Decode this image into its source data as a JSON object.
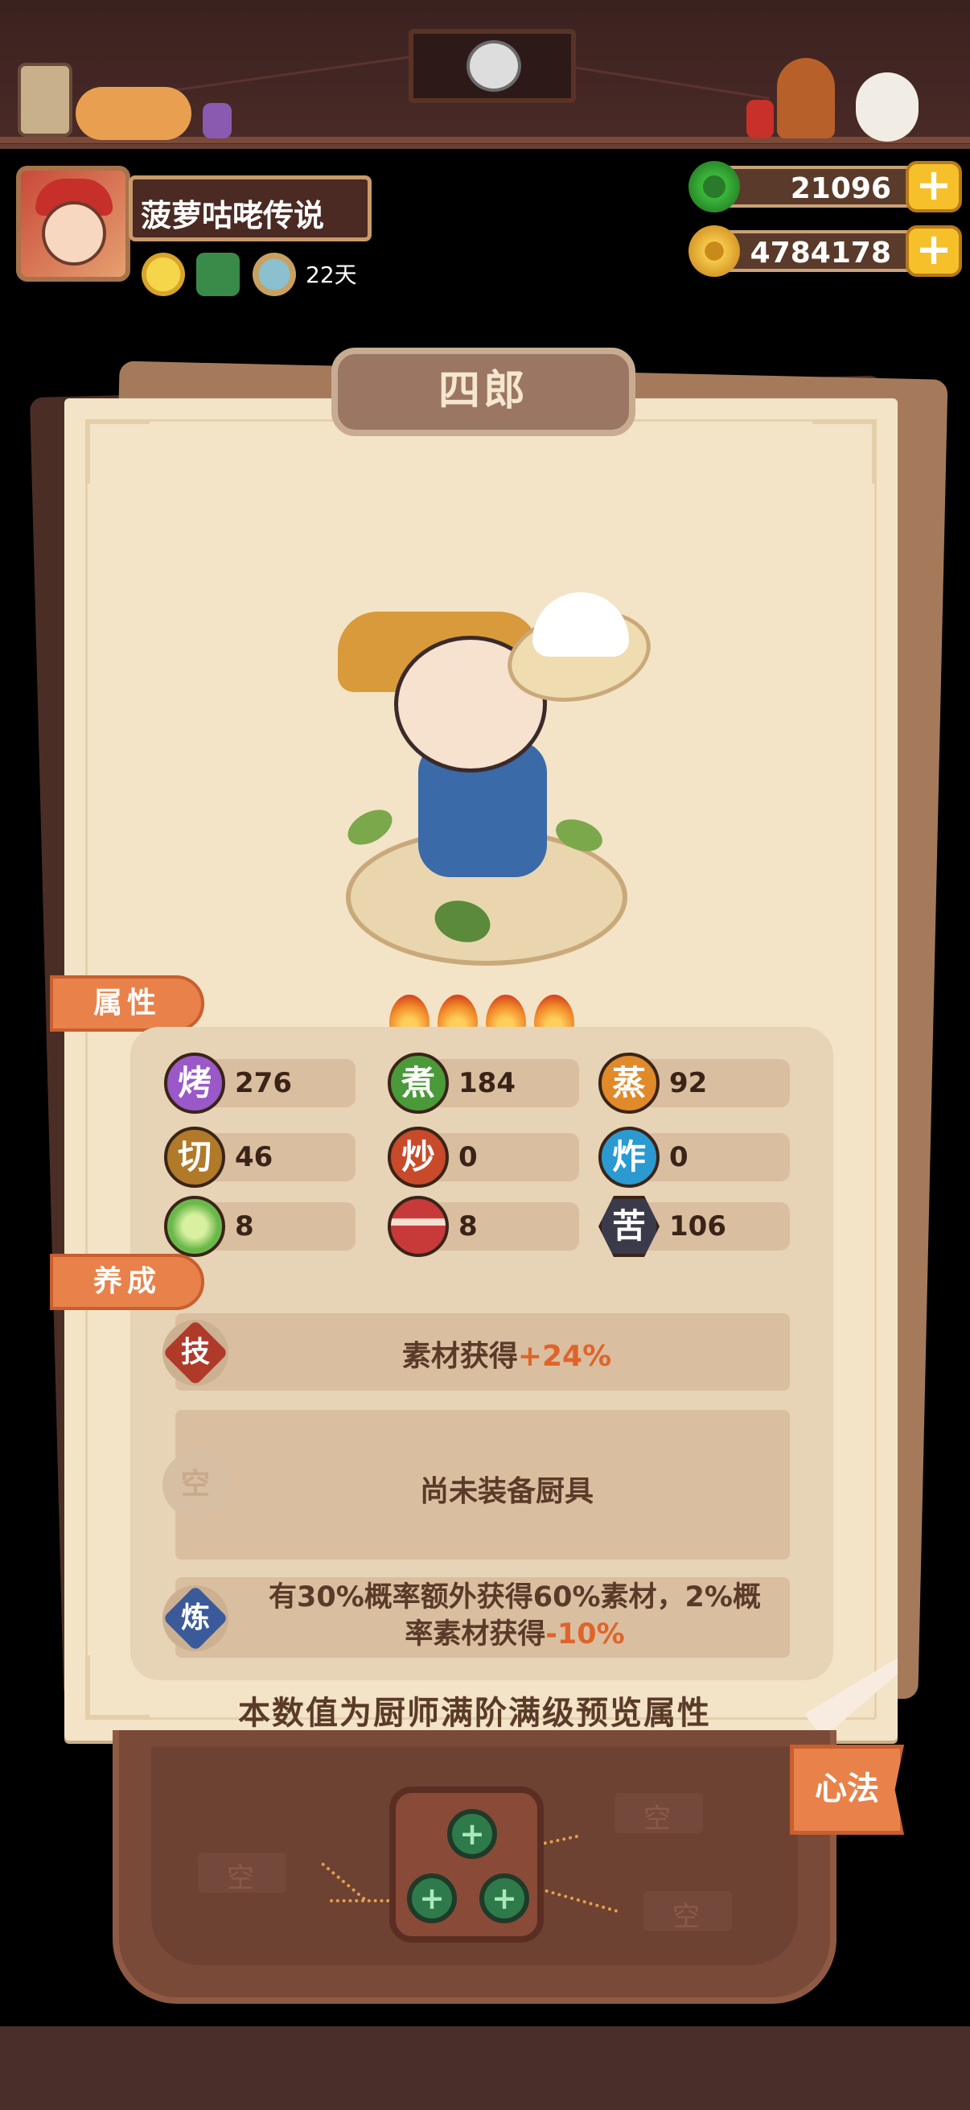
{
  "player": {
    "name": "菠萝咕咾传说",
    "days": "22天"
  },
  "currency": {
    "jade": "21096",
    "coins": "4784178",
    "add_symbol": "+"
  },
  "chef": {
    "name": "四郎",
    "stars": 4
  },
  "tabs": {
    "attributes": "属性",
    "cultivation": "养成",
    "xinfa": "心法"
  },
  "stats": [
    {
      "key": "烤",
      "value": "276",
      "color": "#9a58c8"
    },
    {
      "key": "煮",
      "value": "184",
      "color": "#4a9a3a"
    },
    {
      "key": "蒸",
      "value": "92",
      "color": "#e08a2a"
    },
    {
      "key": "切",
      "value": "46",
      "color": "#b07a2a"
    },
    {
      "key": "炒",
      "value": "0",
      "color": "#c84a2a"
    },
    {
      "key": "炸",
      "value": "0",
      "color": "#2a9ad0"
    },
    {
      "key": "cabbage-icon",
      "value": "8",
      "color": "#6ab84a"
    },
    {
      "key": "meat-icon",
      "value": "8",
      "color": "#c83a3a"
    },
    {
      "key": "苦",
      "value": "106",
      "color": "#3a3a4a"
    }
  ],
  "skill": {
    "badge": "技",
    "text": "素材获得",
    "bonus": "+24%"
  },
  "equipment": {
    "badge": "空",
    "text": "尚未装备厨具"
  },
  "refine": {
    "badge": "炼",
    "line1": "有30%概率额外获得60%素材，2%概",
    "line2_prefix": "率素材获得",
    "line2_bonus": "-10%"
  },
  "footer_note": "本数值为厨师满阶满级预览属性",
  "tray": {
    "empty_label": "空",
    "gem_symbol": "+"
  }
}
